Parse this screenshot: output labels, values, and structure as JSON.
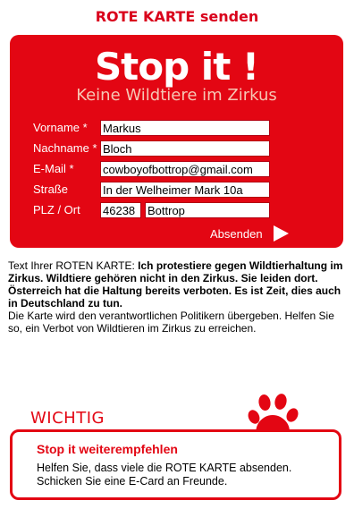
{
  "page": {
    "title": "ROTE KARTE senden"
  },
  "card": {
    "headline": "Stop it !",
    "subtitle": "Keine Wildtiere im Zirkus",
    "fields": {
      "vorname": {
        "label": "Vorname *",
        "value": "Markus"
      },
      "nachname": {
        "label": "Nachname *",
        "value": "Bloch"
      },
      "email": {
        "label": "E-Mail *",
        "value": "cowboyofbottrop@gmail.com"
      },
      "strasse": {
        "label": "Straße",
        "value": "In der Welheimer Mark 10a"
      },
      "plz_ort": {
        "label": "PLZ / Ort",
        "plz": "46238",
        "ort": "Bottrop"
      }
    },
    "submit_label": "Absenden"
  },
  "message": {
    "intro": "Text Ihrer ROTEN KARTE: ",
    "bold": "Ich protestiere gegen Wildtierhaltung im Zirkus. Wildtiere gehören nicht in den Zirkus. Sie leiden dort. Österreich hat die Haltung bereits verboten. Es ist Zeit, dies auch in Deutschland zu tun.",
    "info": "Die Karte wird den verantwortlichen Politikern übergeben. Helfen Sie so, ein Verbot von Wildtieren im Zirkus zu erreichen."
  },
  "important": {
    "label": "WICHTIG",
    "heading": "Stop it weiterempfehlen",
    "body": "Helfen Sie, dass viele die ROTE KARTE absenden. Schicken Sie eine E-Card an Freunde."
  },
  "colors": {
    "brand_red": "#e30613",
    "subtitle_tint": "#f6c7b4"
  },
  "icons": {
    "paw": "paw-print-icon",
    "submit": "play-arrow-icon"
  }
}
